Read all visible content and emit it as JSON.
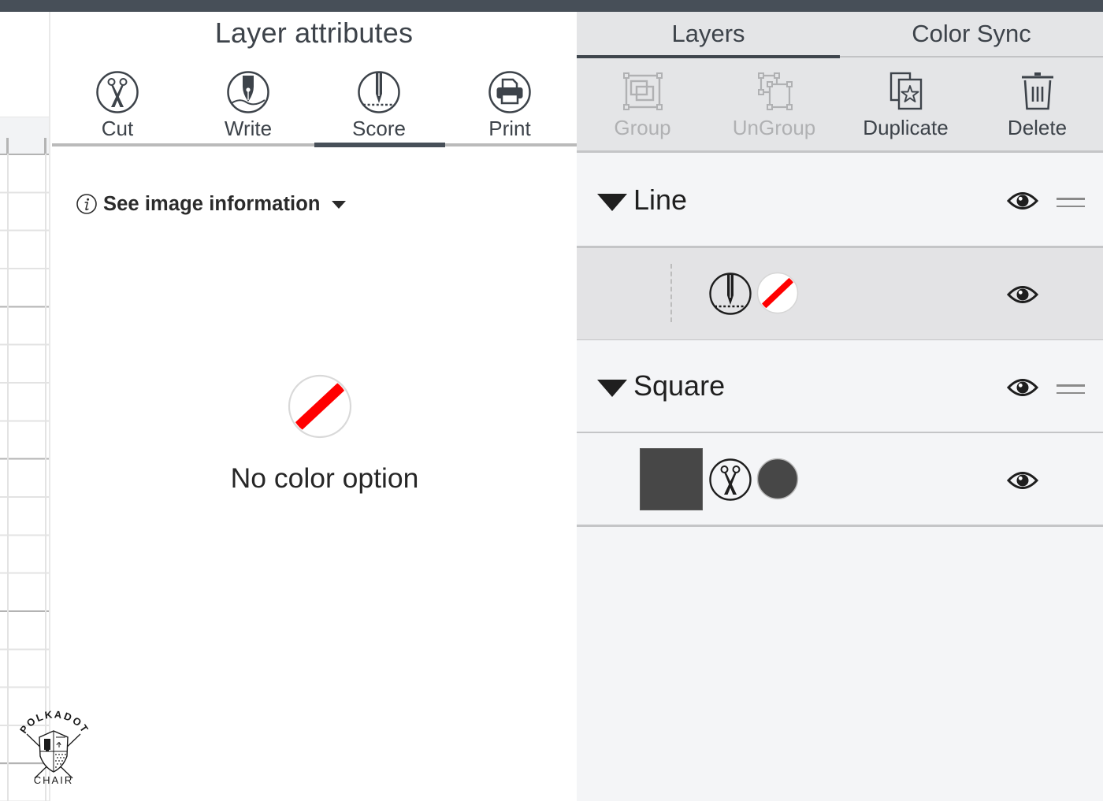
{
  "layer_attributes": {
    "title": "Layer attributes",
    "tabs": [
      {
        "label": "Cut",
        "icon": "scissors-icon",
        "active": false
      },
      {
        "label": "Write",
        "icon": "pen-nib-icon",
        "active": false
      },
      {
        "label": "Score",
        "icon": "scoring-stylus-icon",
        "active": true
      },
      {
        "label": "Print",
        "icon": "printer-icon",
        "active": false
      }
    ],
    "info_link": {
      "label": "See image information",
      "icon": "info-icon"
    },
    "color_state": {
      "label": "No color option",
      "icon": "no-color-icon"
    }
  },
  "layers_panel": {
    "tabs": [
      {
        "label": "Layers",
        "active": true
      },
      {
        "label": "Color Sync",
        "active": false
      }
    ],
    "toolbar": [
      {
        "label": "Group",
        "icon": "group-icon",
        "enabled": false
      },
      {
        "label": "UnGroup",
        "icon": "ungroup-icon",
        "enabled": false
      },
      {
        "label": "Duplicate",
        "icon": "duplicate-icon",
        "enabled": true
      },
      {
        "label": "Delete",
        "icon": "trash-icon",
        "enabled": true
      }
    ],
    "groups": [
      {
        "name": "Line",
        "expanded": true,
        "visible": true,
        "children": [
          {
            "operation": "score",
            "color": "none",
            "visible": true,
            "selected": true
          }
        ]
      },
      {
        "name": "Square",
        "expanded": true,
        "visible": true,
        "children": [
          {
            "shape": "square",
            "operation": "cut",
            "color": "#474747",
            "visible": true,
            "selected": false
          }
        ]
      }
    ]
  },
  "watermark": {
    "top_text": "POLKADOT",
    "bottom_text": "CHAIR"
  },
  "colors": {
    "top_bar": "#474f58",
    "active_tab": "#474f58",
    "no_color_stripe": "#ff0000",
    "disabled_text": "#b0b1b3"
  }
}
